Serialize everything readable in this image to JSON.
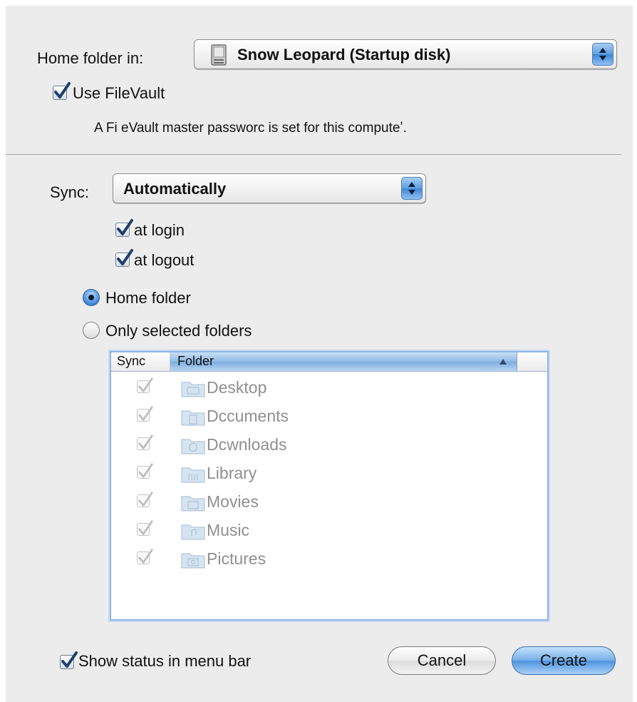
{
  "home_folder": {
    "label": "Home folder in:",
    "disk_value": "Snow Leopard (Startup disk)",
    "icon": "hard-drive-icon"
  },
  "filevault": {
    "checkbox_label": "Use FileVault",
    "checked": true,
    "note": "A Fi eVault master passworc is set for this computeʼ."
  },
  "sync": {
    "label": "Sync:",
    "value": "Automatically",
    "at_login_label": "at login",
    "at_login_checked": true,
    "at_logout_label": "at logout",
    "at_logout_checked": true
  },
  "sync_scope": {
    "home_folder_label": "Home folder",
    "home_folder_selected": true,
    "only_selected_label": "Only selected folders",
    "only_selected_selected": false
  },
  "folder_table": {
    "columns": {
      "sync": "Sync",
      "folder": "Folder"
    },
    "sort_icon": "sort-ascending-icon",
    "rows": [
      {
        "name": "Desktop",
        "checked": true,
        "icon": "desktop-folder-icon"
      },
      {
        "name": "Dccuments",
        "checked": true,
        "icon": "documents-folder-icon"
      },
      {
        "name": "Dcwnloads",
        "checked": true,
        "icon": "downloads-folder-icon"
      },
      {
        "name": "Library",
        "checked": true,
        "icon": "library-folder-icon"
      },
      {
        "name": "Movies",
        "checked": true,
        "icon": "movies-folder-icon"
      },
      {
        "name": "Music",
        "checked": true,
        "icon": "music-folder-icon"
      },
      {
        "name": "Pictures",
        "checked": true,
        "icon": "pictures-folder-icon"
      }
    ]
  },
  "footer": {
    "show_status_label": "Show status in menu bar",
    "show_status_checked": true,
    "cancel_label": "Cancel",
    "create_label": "Create"
  },
  "colors": {
    "window_bg": "#ececec",
    "accent_blue": "#4c93df",
    "disabled_text": "#8f8f8f"
  }
}
